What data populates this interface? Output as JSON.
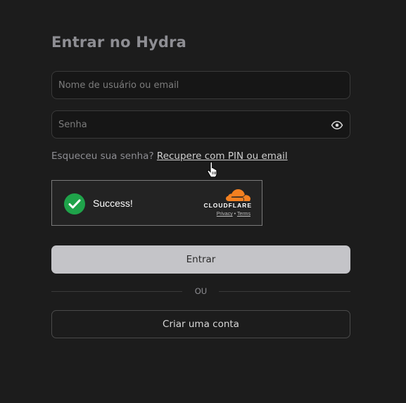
{
  "login": {
    "title": "Entrar no Hydra",
    "username_placeholder": "Nome de usuário ou email",
    "password_placeholder": "Senha",
    "forgot_prefix": "Esqueceu sua senha?",
    "forgot_link": "Recupere com PIN ou email",
    "submit_label": "Entrar",
    "divider_text": "OU",
    "create_account_label": "Criar uma conta"
  },
  "captcha": {
    "status": "Success!",
    "provider": "CLOUDFLARE",
    "privacy_label": "Privacy",
    "separator": "•",
    "terms_label": "Terms"
  },
  "colors": {
    "background": "#1c1c1c",
    "primary_button": "#c4c4c8",
    "success_green": "#1fa34a",
    "cloudflare_orange": "#f38020"
  },
  "icons": {
    "password_toggle": "eye-icon",
    "captcha_status": "check-icon",
    "cursor": "hand-pointer-cursor"
  }
}
